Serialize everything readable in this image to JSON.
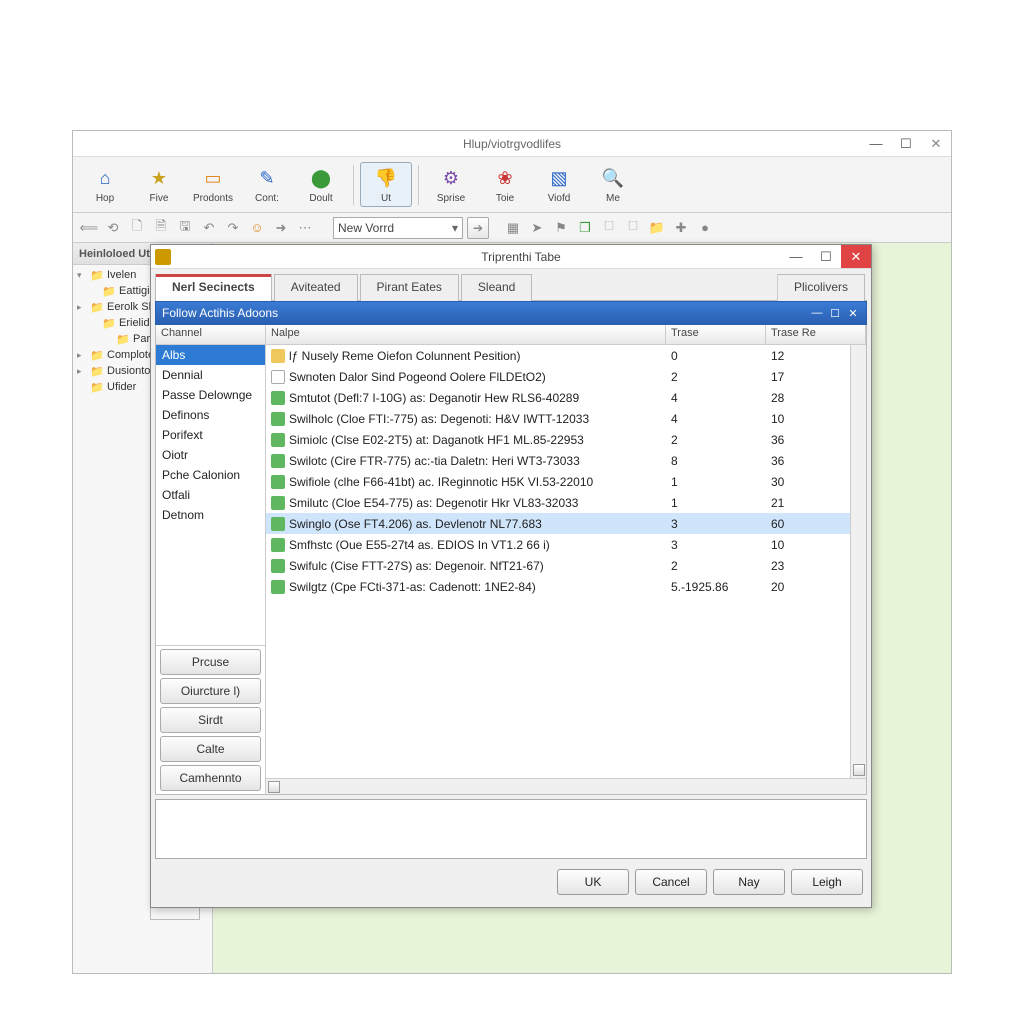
{
  "main_window": {
    "title": "Hlup/viotrgvodlifes",
    "toolbar": [
      {
        "label": "Hop",
        "color": "c-blue"
      },
      {
        "label": "Five",
        "color": "c-yellow"
      },
      {
        "label": "Prodonts",
        "color": "c-orange"
      },
      {
        "label": "Cont:",
        "color": "c-blue"
      },
      {
        "label": "Doult",
        "color": "c-green"
      },
      {
        "label": "Ut",
        "color": "c-blue",
        "pressed": true
      },
      {
        "label": "Sprise",
        "color": "c-purple"
      },
      {
        "label": "Toie",
        "color": "c-red"
      },
      {
        "label": "Viofd",
        "color": "c-blue"
      },
      {
        "label": "Me",
        "color": "c-grey"
      }
    ],
    "combo_value": "New Vorrd",
    "sidebar_title": "Heinloloed Ute",
    "tree": [
      {
        "label": "Ivelen",
        "indent": 0,
        "exp": "▾",
        "color": "c-green"
      },
      {
        "label": "Eattigiotions",
        "indent": 1,
        "exp": "",
        "color": "c-blue"
      },
      {
        "label": "Eerolk Sbelution",
        "indent": 0,
        "exp": "▸",
        "color": "c-blue"
      },
      {
        "label": "Erieliderme",
        "indent": 1,
        "exp": "",
        "color": "c-yellow"
      },
      {
        "label": "Pard Fiuecion",
        "indent": 2,
        "exp": "",
        "color": "c-grey"
      },
      {
        "label": "Complote Recsiod",
        "indent": 0,
        "exp": "▸",
        "color": "c-green"
      },
      {
        "label": "Dusiontons",
        "indent": 0,
        "exp": "▸",
        "color": "c-blue"
      },
      {
        "label": "Ufider",
        "indent": 0,
        "exp": "",
        "color": "c-grey"
      }
    ]
  },
  "dialog": {
    "title": "Triprenthi Tabe",
    "tabs": [
      "Nerl Secinects",
      "Aviteated",
      "Pirant Eates",
      "Sleand"
    ],
    "tab_right": "Plicolivers",
    "bluebar_title": "Follow Actihis Adoons",
    "left_header": "Channel",
    "categories": [
      "Albs",
      "Dennial",
      "Passe Delownge",
      "Definons",
      "Porifext",
      "Oiotr",
      "Pche Calonion",
      "Otfali",
      "Detnom"
    ],
    "selected_category_index": 0,
    "left_buttons": [
      "Prcuse",
      "Oiurcture l)",
      "Sirdt",
      "Calte",
      "Camhennto"
    ],
    "columns": [
      "Nalpe",
      "Trase",
      "Trase Re"
    ],
    "rows": [
      {
        "ico": "y",
        "name": "lƒ Nusely Reme Oiefon Colunnent Pesition)",
        "trase": "0",
        "re": "12"
      },
      {
        "ico": "c",
        "name": "Swnoten Dalor Sind Pogeond Oolere FlLDEtO2)",
        "trase": "2",
        "re": "17"
      },
      {
        "ico": "g",
        "name": "Smtutot (Defl:7 I-10G) as: Deganotir Hew RLS6-40289",
        "trase": "4",
        "re": "28"
      },
      {
        "ico": "g",
        "name": "Swilholc (Cloe FTI:-775) as: Degenoti: H&V IWTT-12033",
        "trase": "4",
        "re": "10"
      },
      {
        "ico": "g",
        "name": "Simiolc (Clse E02-2T5) at: Daganotk HF1 ML.85-22953",
        "trase": "2",
        "re": "36"
      },
      {
        "ico": "g",
        "name": "Swilotc (Cire FTR-775) ac:-tia Daletn: Heri WT3-73033",
        "trase": "8",
        "re": "36"
      },
      {
        "ico": "g",
        "name": "Swifiole (clhe F66-41bt) ac. IReginnotic H5K VI.53-22010",
        "trase": "1",
        "re": "30"
      },
      {
        "ico": "g",
        "name": "Smilutc (Cloe E54-775) as: Degenotir Hkr VL83-32033",
        "trase": "1",
        "re": "21"
      },
      {
        "ico": "g",
        "name": "Swinglo (Ose FT4.206) as. Devlenotr NL77.683",
        "trase": "3",
        "re": "60",
        "selected": true
      },
      {
        "ico": "g",
        "name": "Smfhstc (Oue E55-27t4 as. EDIOS In VT1.2 66 i)",
        "trase": "3",
        "re": "10"
      },
      {
        "ico": "g",
        "name": "Swifulc (Cise FTT-27S) as: Degenoir. NfT21-67)",
        "trase": "2",
        "re": "23"
      },
      {
        "ico": "g",
        "name": "Swilgtz (Cpe FCti-371-as: Cadenott: 1NE2-84)",
        "trase": "5.-1925.86",
        "re": "20"
      }
    ],
    "buttons": [
      "UK",
      "Cancel",
      "Nay",
      "Leigh"
    ]
  }
}
